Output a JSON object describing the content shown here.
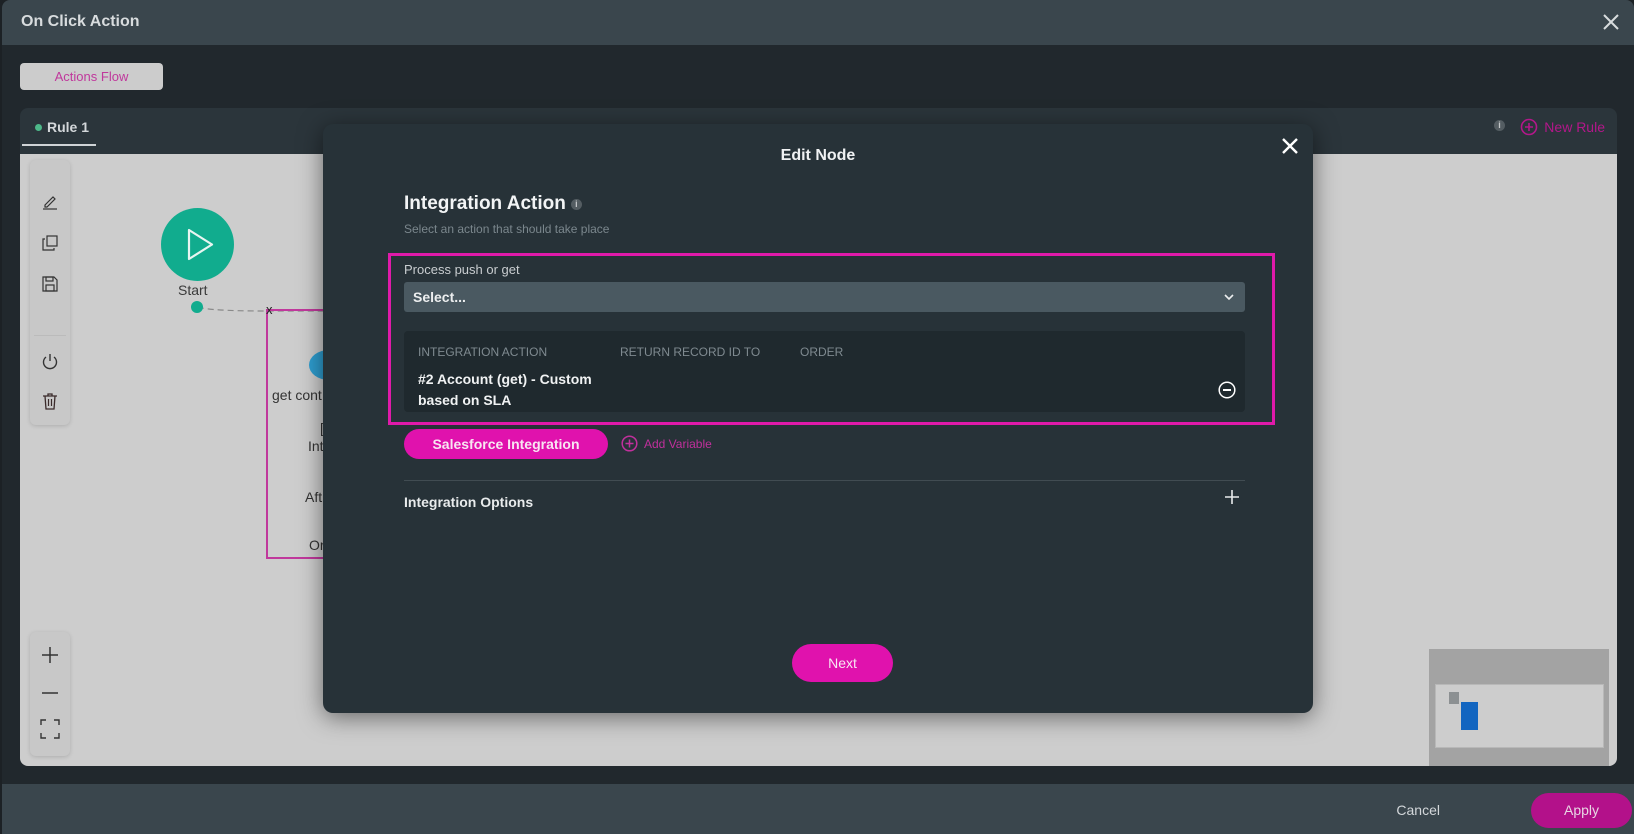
{
  "window": {
    "title": "On Click Action",
    "close_icon": "close-icon"
  },
  "tabs": {
    "actions_flow": "Actions Flow"
  },
  "rule": {
    "tab_label": "Rule 1",
    "status_color": "#4db889",
    "info_glyph": "i",
    "new_rule_label": "New Rule"
  },
  "toolbar": {
    "items": [
      "edit-icon",
      "copy-icon",
      "save-icon",
      "power-icon",
      "trash-icon"
    ]
  },
  "zoom_controls": {
    "items": [
      "zoom-in-icon",
      "zoom-out-icon",
      "fit-screen-icon"
    ]
  },
  "flow": {
    "start_label": "Start",
    "node_x": "x",
    "node_texts": [
      "get cont",
      "[",
      "Int",
      "Aft",
      "Or"
    ]
  },
  "footer": {
    "cancel_label": "Cancel",
    "apply_label": "Apply"
  },
  "modal": {
    "title": "Edit Node",
    "section_title": "Integration Action",
    "info_glyph": "i",
    "section_subtitle": "Select an action that should take place",
    "field_label": "Process push or get",
    "select_value": "Select...",
    "table": {
      "headers": [
        "INTEGRATION ACTION",
        "RETURN RECORD ID TO",
        "ORDER"
      ],
      "rows": [
        {
          "integration_action": "#2 Account (get) - Custom based on SLA",
          "return_record_id_to": "",
          "order": ""
        }
      ]
    },
    "salesforce_button": "Salesforce Integration",
    "add_variable": "Add Variable",
    "integration_options": "Integration Options",
    "next_button": "Next"
  },
  "colors": {
    "accent": "#e012ad",
    "apply": "#b3118a",
    "start_node": "#11ac8e",
    "minimap_node": "#1265c0"
  }
}
